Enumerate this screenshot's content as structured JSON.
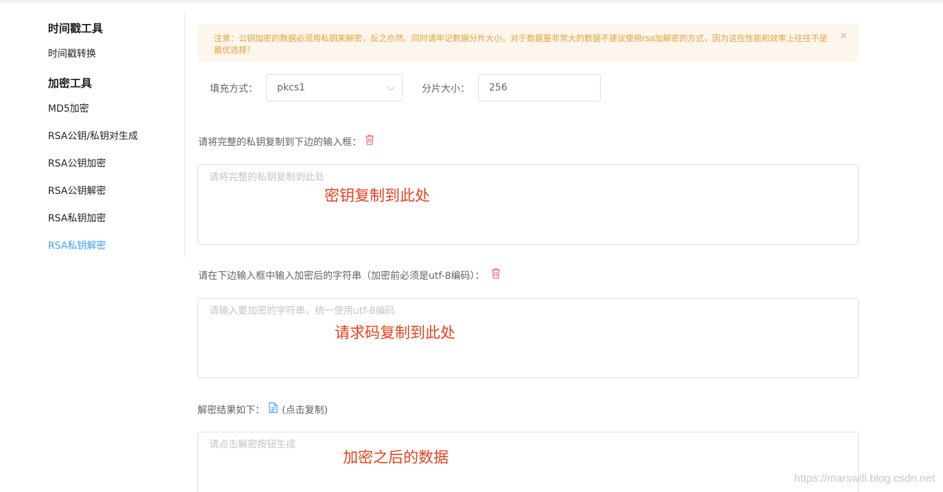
{
  "sidebar": {
    "groups": [
      {
        "title": "时间戳工具",
        "items": [
          "时间戳转换"
        ]
      },
      {
        "title": "加密工具",
        "items": [
          "MD5加密",
          "RSA公钥/私钥对生成",
          "RSA公钥加密",
          "RSA公钥解密",
          "RSA私钥加密",
          "RSA私钥解密"
        ]
      }
    ],
    "active_item": "RSA私钥解密"
  },
  "alert": {
    "text": "注意：公钥加密的数据必须用私钥来解密，反之亦然。同时请牢记数据分片大小。对于数据量非常大的数据不建议使用rsa加解密的方式，因为这在性能和效率上往往不是最优选择！",
    "close_icon": "close-icon"
  },
  "form": {
    "padding_label": "填充方式：",
    "padding_value": "pkcs1",
    "chunk_label": "分片大小：",
    "chunk_value": "256"
  },
  "private_key": {
    "label": "请将完整的私钥复制到下边的输入框：",
    "placeholder": "请将完整的私钥复制到此处",
    "annotation": "密钥复制到此处"
  },
  "cipher": {
    "label": "请在下边输入框中输入加密后的字符串（加密前必须是utf-8编码）：",
    "placeholder": "请输入要加密的字符串，统一使用utf-8编码",
    "annotation": "请求码复制到此处"
  },
  "result": {
    "label": "解密结果如下：",
    "copy_label": "(点击复制)",
    "placeholder": "请点击解密按钮生成",
    "annotation": "加密之后的数据"
  },
  "watermark": "https://marswill.blog.csdn.net",
  "colors": {
    "accent": "#409eff",
    "warning_bg": "#fdf6ec",
    "warning_text": "#e6a23c",
    "danger": "#f56c6c",
    "annotation": "#e8401c"
  }
}
